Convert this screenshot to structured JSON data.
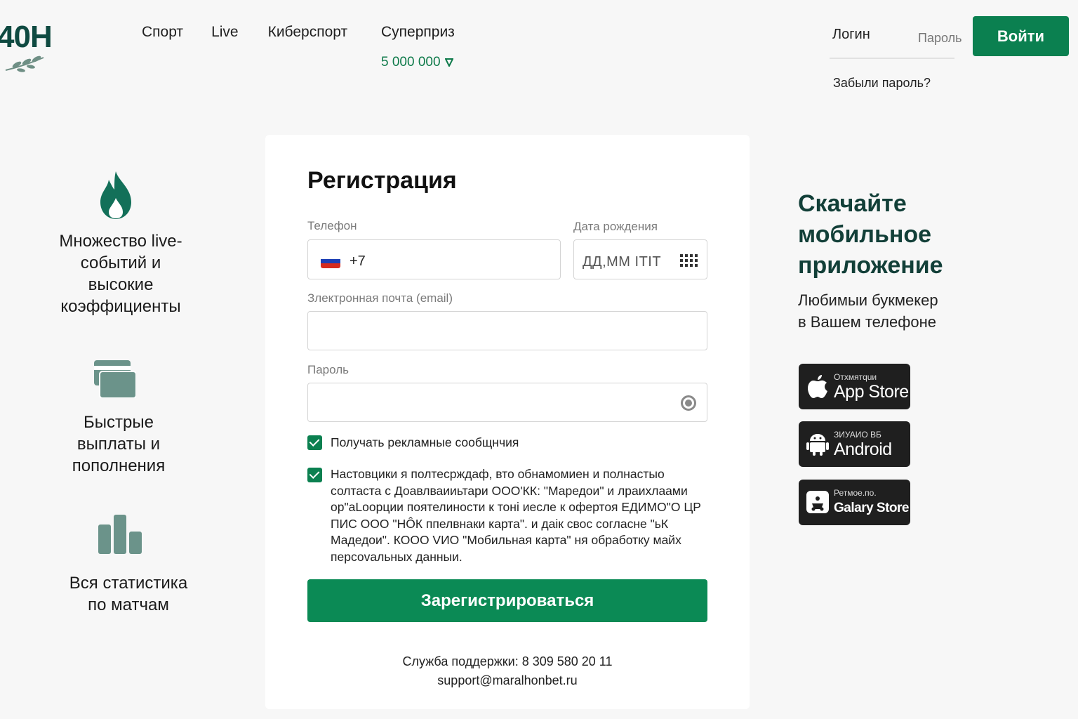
{
  "header": {
    "logo_text": "40H",
    "nav": [
      "Спорт",
      "Live",
      "Киберспорт"
    ],
    "superprize_label": "Суперприз",
    "superprize_amount": "5 000 000",
    "login_label": "Логин",
    "password_label": "Пароль",
    "forgot_password": "Забыли пароль?",
    "login_button": "Войти"
  },
  "features": {
    "f1": "Множество live-событий и высокие коэффициенты",
    "f2": "Быстрые выплаты и пополнения",
    "f3": "Вся статистика по матчам"
  },
  "form": {
    "title": "Регистрация",
    "phone_label": "Телефон",
    "phone_prefix": "+7",
    "birth_label": "Дата рождения",
    "birth_placeholder": "ДД,ММ ITIT",
    "email_label": "Злектронная почта (email)",
    "password_label": "Пароль",
    "checkbox1_text": "Получать рекламные сообщнчия",
    "checkbox2_text": "Настовцики я полтесрждаф, вто обнамомиен и полнастыо солтаста с Доавлваииьтари ООО'КК: \"Маредои\" и лраихлаами ор\"аLоорции поятелиности  к тонi иесле к офертоя ЕДИМО\"О ЦР ПИС ООО \"НÔК ппелвнаки карта\". и даік свос согласне \"ьК Мадедои\". КООО VИО \"Мобильная карта\" ня обработку майх персоvальных данныи.",
    "register_button": "Зарегистрироваться",
    "support_phone": "Служба поддержки: 8 309 580 20 11",
    "support_email": "support@maralhonbet.ru"
  },
  "app": {
    "title_line1": "Скачайте",
    "title_line2": "мобильное",
    "title_line3": "приложение",
    "subtitle_line1": "Любимыи букмекер",
    "subtitle_line2": "в Вашем телефоне",
    "stores": [
      {
        "small": "Отхмятquи",
        "big": "App Store",
        "icon": "apple-icon"
      },
      {
        "small": "ЗИУАИО ВБ",
        "big": "Android",
        "icon": "android-icon"
      },
      {
        "small": "Ретмое.по.",
        "big": "Galary Store",
        "icon": "galaxy-store-icon"
      }
    ]
  },
  "colors": {
    "brand_green": "#0b8050",
    "dark_teal": "#0f4a41",
    "icon_teal": "#5e8a7e"
  }
}
